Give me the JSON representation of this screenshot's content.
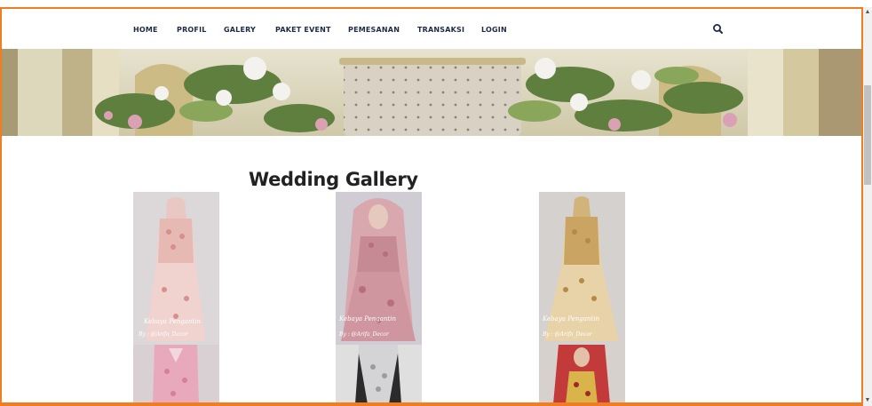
{
  "nav": {
    "items": [
      "HOME",
      "PROFIL",
      "GALERY",
      "PAKET EVENT",
      "PEMESANAN",
      "TRANSAKSI",
      "LOGIN"
    ],
    "search_icon": "search-icon"
  },
  "gallery": {
    "title": "Wedding Gallery",
    "captions": [
      [
        "Kebaya Pengantin",
        "By : @Arifa_Decor"
      ],
      [
        "Kebaya Pengantin",
        "By : @Arifa_Decor"
      ],
      [
        "Kebaya Pengantin",
        "By : @Arifa_Decor"
      ]
    ]
  },
  "colors": {
    "frame_border": "#f07d22",
    "nav_text": "#1f2a44",
    "title_text": "#222222"
  }
}
